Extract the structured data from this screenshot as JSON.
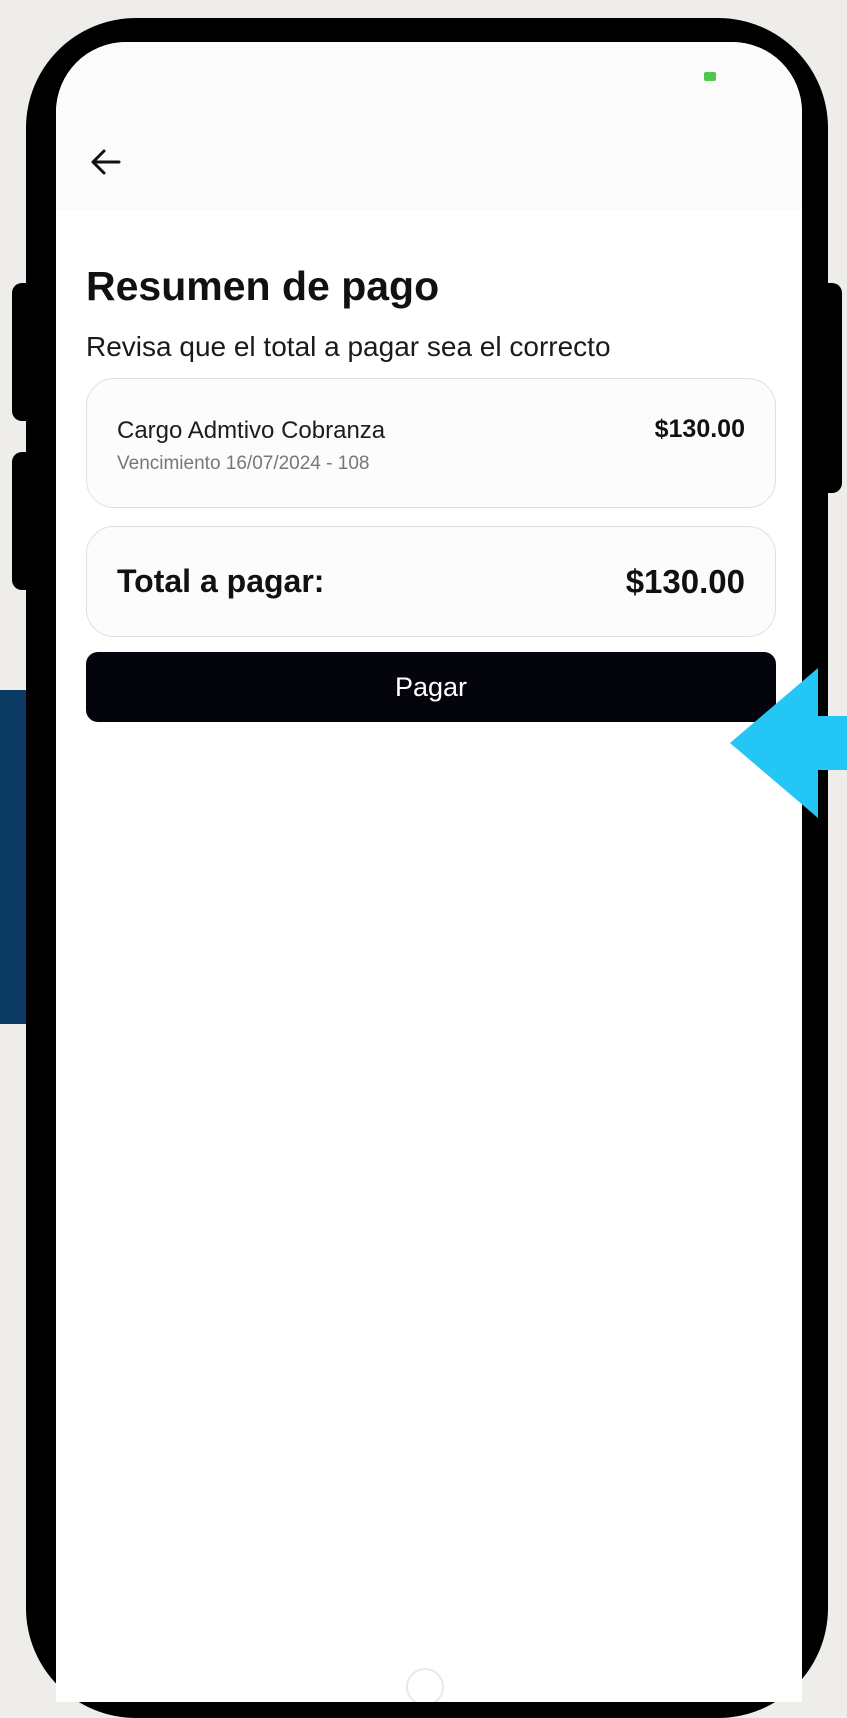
{
  "header": {
    "back_icon": "arrow-left-icon"
  },
  "page": {
    "title": "Resumen de pago",
    "subtitle": "Revisa que el total a pagar sea el correcto"
  },
  "charge_item": {
    "name": "Cargo Admtivo Cobranza",
    "due_text": "Vencimiento 16/07/2024 - 108",
    "amount": "$130.00"
  },
  "total": {
    "label": "Total a pagar:",
    "amount": "$130.00"
  },
  "actions": {
    "pay_label": "Pagar"
  },
  "colors": {
    "pay_button": "#04040c",
    "accent_arrow": "#23c6f5",
    "side_panel": "#0c3b63"
  }
}
